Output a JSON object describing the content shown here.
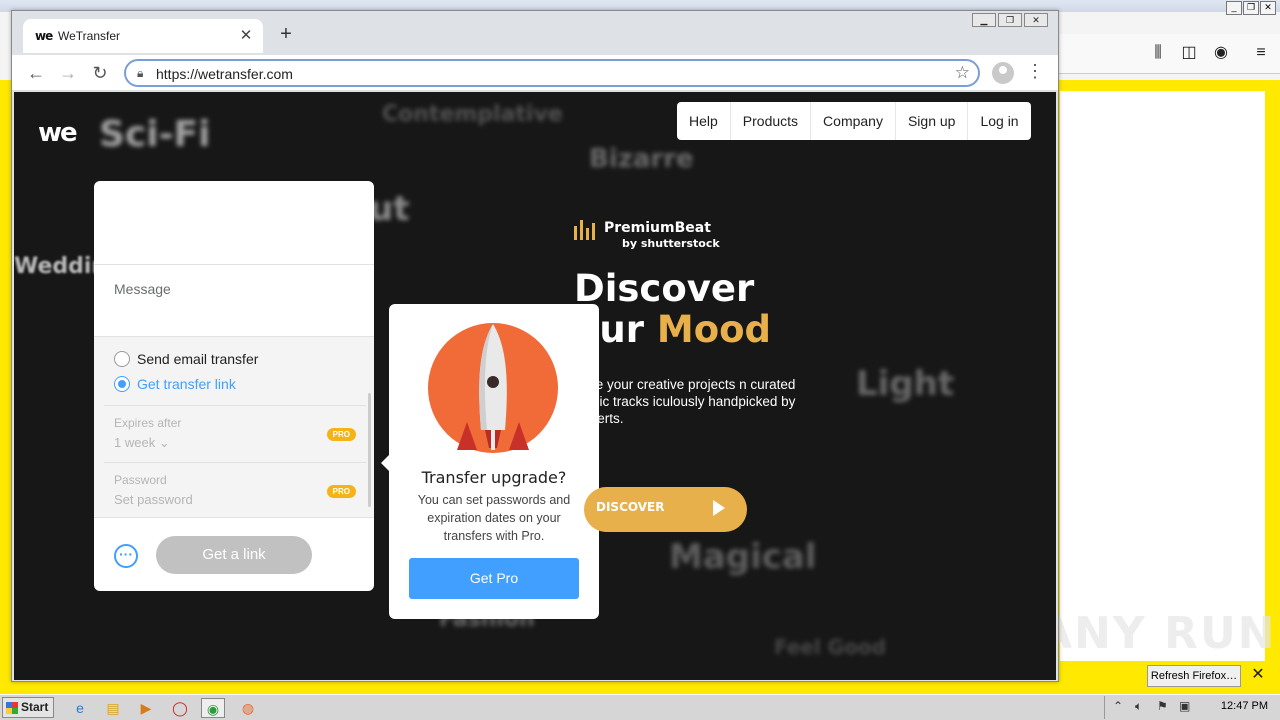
{
  "browser": {
    "tab_title": "WeTransfer",
    "tab_favicon": "we",
    "tab_close": "✕",
    "new_tab": "+",
    "url": "https://wetransfer.com",
    "icons": {
      "back": "back-arrow-icon",
      "forward": "forward-arrow-icon",
      "reload": "reload-icon",
      "lock": "lock-icon",
      "bookmark": "star-icon",
      "profile": "profile-icon",
      "menu": "kebab-menu-icon"
    }
  },
  "page": {
    "logo": "we",
    "background_words": [
      "Sci-Fi",
      "Bizarre",
      "Wedding",
      "Light",
      "Magical",
      "Fashion"
    ],
    "nav": [
      "Help",
      "Products",
      "Company",
      "Sign up",
      "Log in"
    ]
  },
  "transfer_panel": {
    "message_label": "Message",
    "option_email": "Send email transfer",
    "option_link": "Get transfer link",
    "selected_option": "link",
    "expires_label": "Expires after",
    "expires_value": "1 week",
    "password_label": "Password",
    "password_placeholder": "Set password",
    "pro_badge": "PRO",
    "more_button": "···",
    "get_link_button": "Get a link"
  },
  "upgrade_popup": {
    "title": "Transfer upgrade?",
    "body": "You can set passwords and expiration dates on your transfers with Pro.",
    "button": "Get Pro"
  },
  "ad": {
    "brand_name": "PremiumBeat",
    "brand_sub": "by shutterstock",
    "heading_line1": "Discover",
    "heading_line2_prefix": "our ",
    "heading_line2_accent": "Mood",
    "description": "ance your creative projects n curated music tracks iculously handpicked by our erts.",
    "button": "DISCOVER",
    "accent_color": "#e8b04a"
  },
  "firefox_background": {
    "refresh_button": "Refresh Firefox…",
    "close": "✕",
    "watermark": "ANY RUN"
  },
  "taskbar": {
    "start": "Start",
    "clock": "12:47 PM"
  },
  "colors": {
    "wetransfer_blue": "#409fff",
    "pro_badge": "#f5b315",
    "rocket_circle": "#f06b37",
    "page_bg": "#171717",
    "firefox_yellow": "#ffe900"
  }
}
